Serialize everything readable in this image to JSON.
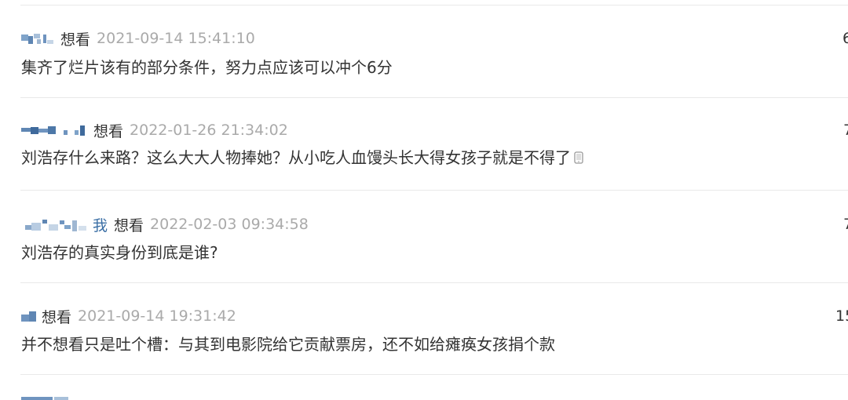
{
  "comments": [
    {
      "rating": "想看",
      "time": "2021-09-14 15:41:10",
      "votes": "6",
      "content": "集齐了烂片该有的部分条件，努力点应该可以冲个6分"
    },
    {
      "rating": "想看",
      "time": "2022-01-26 21:34:02",
      "votes": "7",
      "content": "刘浩存什么来路？这么大大人物捧她？从小吃人血馒头长大得女孩子就是不得了",
      "icon": "mobile-phone-icon"
    },
    {
      "user_flag": "我",
      "rating": "想看",
      "time": "2022-02-03 09:34:58",
      "votes": "7",
      "content": "刘浩存的真实身份到底是谁?"
    },
    {
      "rating": "想看",
      "time": "2021-09-14 19:31:42",
      "votes": "15",
      "content": "并不想看只是吐个槽：与其到电影院给它贡献票房，还不如给瘫痪女孩捐个款"
    }
  ],
  "colors": {
    "text": "#333333",
    "time": "#aaaaaa",
    "user_link": "#3b6fa5",
    "divider": "#e9e9e9",
    "pixelated_avatar": "#6f94bf"
  }
}
